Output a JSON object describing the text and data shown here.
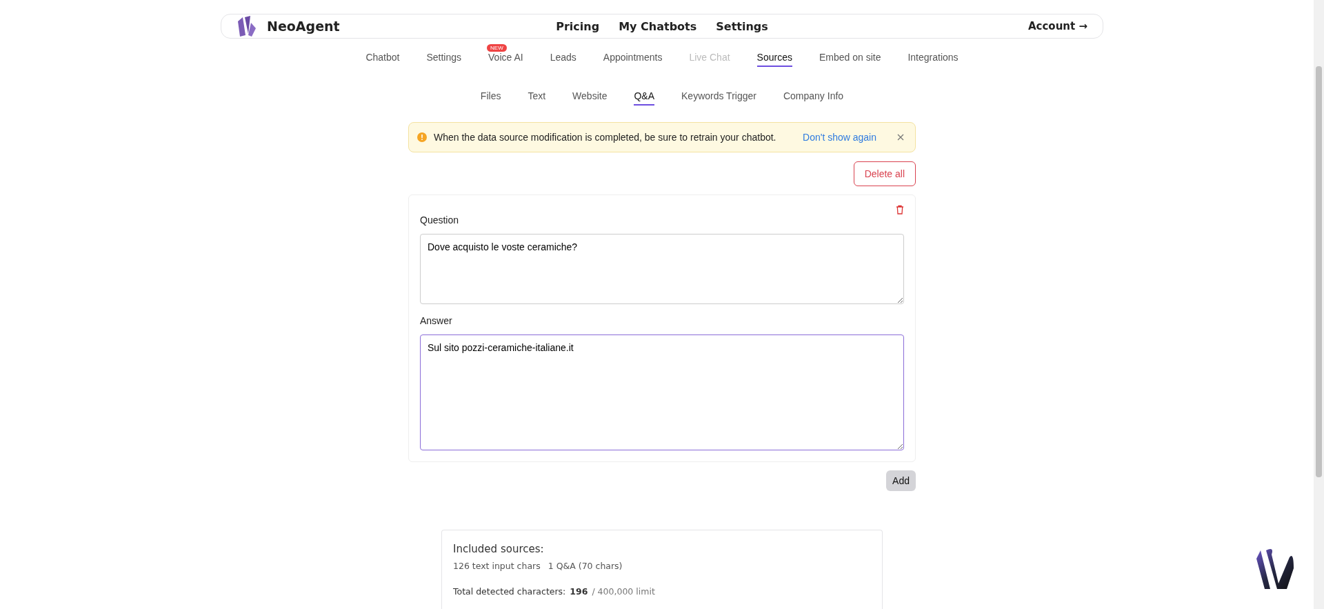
{
  "header": {
    "brand": "NeoAgent",
    "nav": [
      "Pricing",
      "My Chatbots",
      "Settings"
    ],
    "account": "Account →"
  },
  "tabs": [
    {
      "label": "Chatbot",
      "selected": false,
      "disabled": false
    },
    {
      "label": "Settings",
      "selected": false,
      "disabled": false
    },
    {
      "label": "Voice AI",
      "selected": false,
      "disabled": false,
      "badge": "NEW"
    },
    {
      "label": "Leads",
      "selected": false,
      "disabled": false
    },
    {
      "label": "Appointments",
      "selected": false,
      "disabled": false
    },
    {
      "label": "Live Chat",
      "selected": false,
      "disabled": true
    },
    {
      "label": "Sources",
      "selected": true,
      "disabled": false
    },
    {
      "label": "Embed on site",
      "selected": false,
      "disabled": false
    },
    {
      "label": "Integrations",
      "selected": false,
      "disabled": false
    }
  ],
  "subtabs": [
    {
      "label": "Files",
      "selected": false
    },
    {
      "label": "Text",
      "selected": false
    },
    {
      "label": "Website",
      "selected": false
    },
    {
      "label": "Q&A",
      "selected": true
    },
    {
      "label": "Keywords Trigger",
      "selected": false
    },
    {
      "label": "Company Info",
      "selected": false
    }
  ],
  "alert": {
    "message": "When the data source modification is completed, be sure to retrain your chatbot.",
    "link": "Don't show again"
  },
  "delete_all": "Delete all",
  "qa": {
    "question_label": "Question",
    "question": "Dove acquisto le voste ceramiche?",
    "question_focused": false,
    "answer_label": "Answer",
    "answer": "Sul sito pozzi-ceramiche-italiane.it",
    "answer_focused": true
  },
  "add": "Add",
  "summary": {
    "title": "Included sources:",
    "items": [
      "126 text input chars",
      "1 Q&A (70 chars)"
    ],
    "total_label": "Total detected characters:",
    "total": "196",
    "limit": "/ 400,000 limit"
  }
}
